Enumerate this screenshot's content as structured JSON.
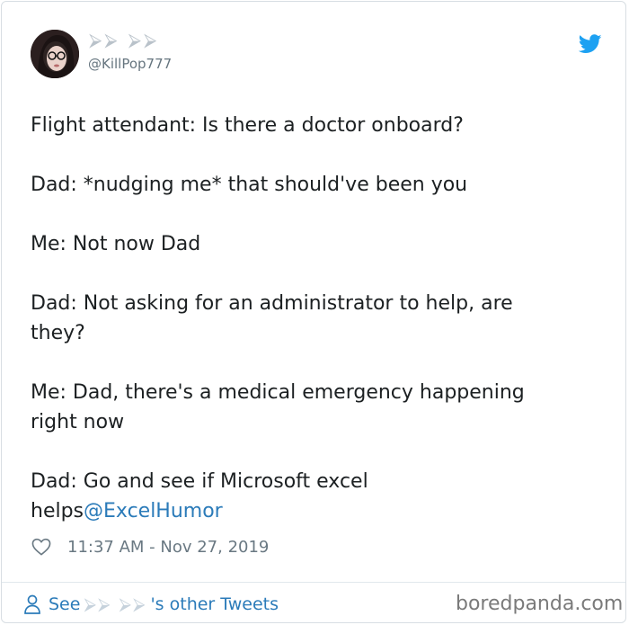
{
  "author": {
    "display_name": "⮚⮚ ⮚⮚",
    "handle": "@KillPop777"
  },
  "tweet": {
    "text": "Flight attendant: Is there a doctor onboard?\n\nDad: *nudging me* that should've been you\n\nMe: Not now Dad\n\nDad: Not asking for an administrator to help, are\nthey?\n\nMe: Dad, there's a medical emergency happening\nright now\n\nDad: Go and see if Microsoft excel\nhelps",
    "mention": "@ExcelHumor",
    "timestamp": "11:37 AM - Nov 27, 2019"
  },
  "footer": {
    "see_label": "See",
    "name_glyphs": "⮚⮚ ⮚⮚",
    "suffix_label": "'s other Tweets",
    "watermark": "boredpanda.com"
  },
  "icons": {
    "bird": "twitter-bird-icon",
    "heart": "heart-icon",
    "person": "person-icon"
  },
  "colors": {
    "link": "#2b7bb9",
    "bird": "#1da1f2",
    "meta": "#697882"
  }
}
